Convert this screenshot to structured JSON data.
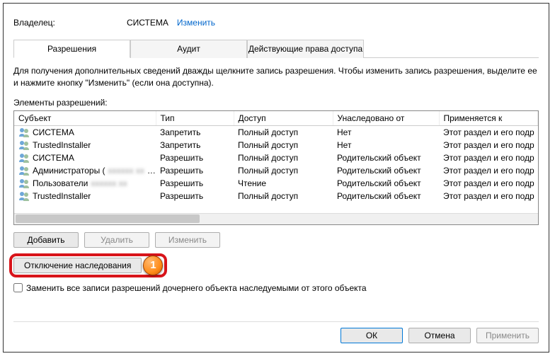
{
  "owner": {
    "label": "Владелец:",
    "value": "СИСТЕМА",
    "change": "Изменить"
  },
  "tabs": {
    "permissions": "Разрешения",
    "audit": "Аудит",
    "effective": "Действующие права доступа"
  },
  "help_text": "Для получения дополнительных сведений дважды щелкните запись разрешения. Чтобы изменить запись разрешения, выделите ее и нажмите кнопку \"Изменить\" (если она доступна).",
  "elements_label": "Элементы разрешений:",
  "columns": {
    "subject": "Субъект",
    "type": "Тип",
    "access": "Доступ",
    "inherited": "Унаследовано от",
    "applies": "Применяется к"
  },
  "rows": [
    {
      "subject": "СИСТЕМА",
      "type": "Запретить",
      "access": "Полный доступ",
      "inherited": "Нет",
      "applies": "Этот раздел и его подр"
    },
    {
      "subject": "TrustedInstaller",
      "type": "Запретить",
      "access": "Полный доступ",
      "inherited": "Нет",
      "applies": "Этот раздел и его подр"
    },
    {
      "subject": "СИСТЕМА",
      "type": "Разрешить",
      "access": "Полный доступ",
      "inherited": "Родительский объект",
      "applies": "Этот раздел и его подр"
    },
    {
      "subject": "Администраторы (",
      "type": "Разрешить",
      "access": "Полный доступ",
      "inherited": "Родительский объект",
      "applies": "Этот раздел и его подр"
    },
    {
      "subject": "Пользователи",
      "type": "Разрешить",
      "access": "Чтение",
      "inherited": "Родительский объект",
      "applies": "Этот раздел и его подр"
    },
    {
      "subject": "TrustedInstaller",
      "type": "Разрешить",
      "access": "Полный доступ",
      "inherited": "Родительский объект",
      "applies": "Этот раздел и его подр"
    }
  ],
  "buttons": {
    "add": "Добавить",
    "remove": "Удалить",
    "edit": "Изменить",
    "disable_inherit": "Отключение наследования",
    "ok": "ОК",
    "cancel": "Отмена",
    "apply": "Применить"
  },
  "checkbox_label": "Заменить все записи разрешений дочернего объекта наследуемыми от этого объекта",
  "marker": "1"
}
